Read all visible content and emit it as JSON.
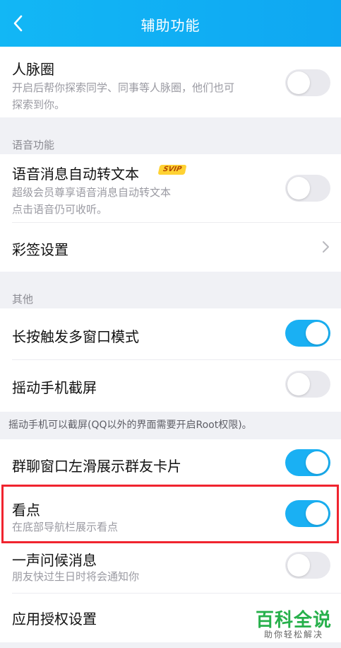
{
  "header": {
    "title": "辅助功能"
  },
  "renmai": {
    "title": "人脉圈",
    "desc_line1": "开启后帮你探索同学、同事等人脉圈，他们也可",
    "desc_line2": "探索到你。",
    "enabled": false
  },
  "voice_section": {
    "label": "语音功能",
    "voice_to_text": {
      "title": "语音消息自动转文本",
      "badge": "SVIP",
      "desc_line1": "超级会员尊享语音消息自动转文本",
      "desc_line2": "点击语音仍可收听。",
      "enabled": false
    },
    "caiqian": {
      "title": "彩签设置"
    }
  },
  "other_section": {
    "label": "其他",
    "long_press": {
      "title": "长按触发多窗口模式",
      "enabled": true
    },
    "shake": {
      "title": "摇动手机截屏",
      "enabled": false
    },
    "shake_note": "摇动手机可以截屏(QQ以外的界面需要开启Root权限)。"
  },
  "more": {
    "group_swipe": {
      "title": "群聊窗口左滑展示群友卡片",
      "enabled": true
    },
    "kandian": {
      "title": "看点",
      "desc": "在底部导航栏展示看点",
      "enabled": true
    },
    "greeting": {
      "title": "一声问候消息",
      "desc": "朋友快过生日时将会通知你",
      "enabled": false
    },
    "app_auth": {
      "title": "应用授权设置"
    }
  },
  "watermark": {
    "main": "百科全说",
    "sub": "助你轻松解决"
  },
  "colors": {
    "header": "#12b7f5",
    "toggle_on": "#1ab0f3",
    "highlight": "#f0242f",
    "watermark": "#27b04b"
  }
}
